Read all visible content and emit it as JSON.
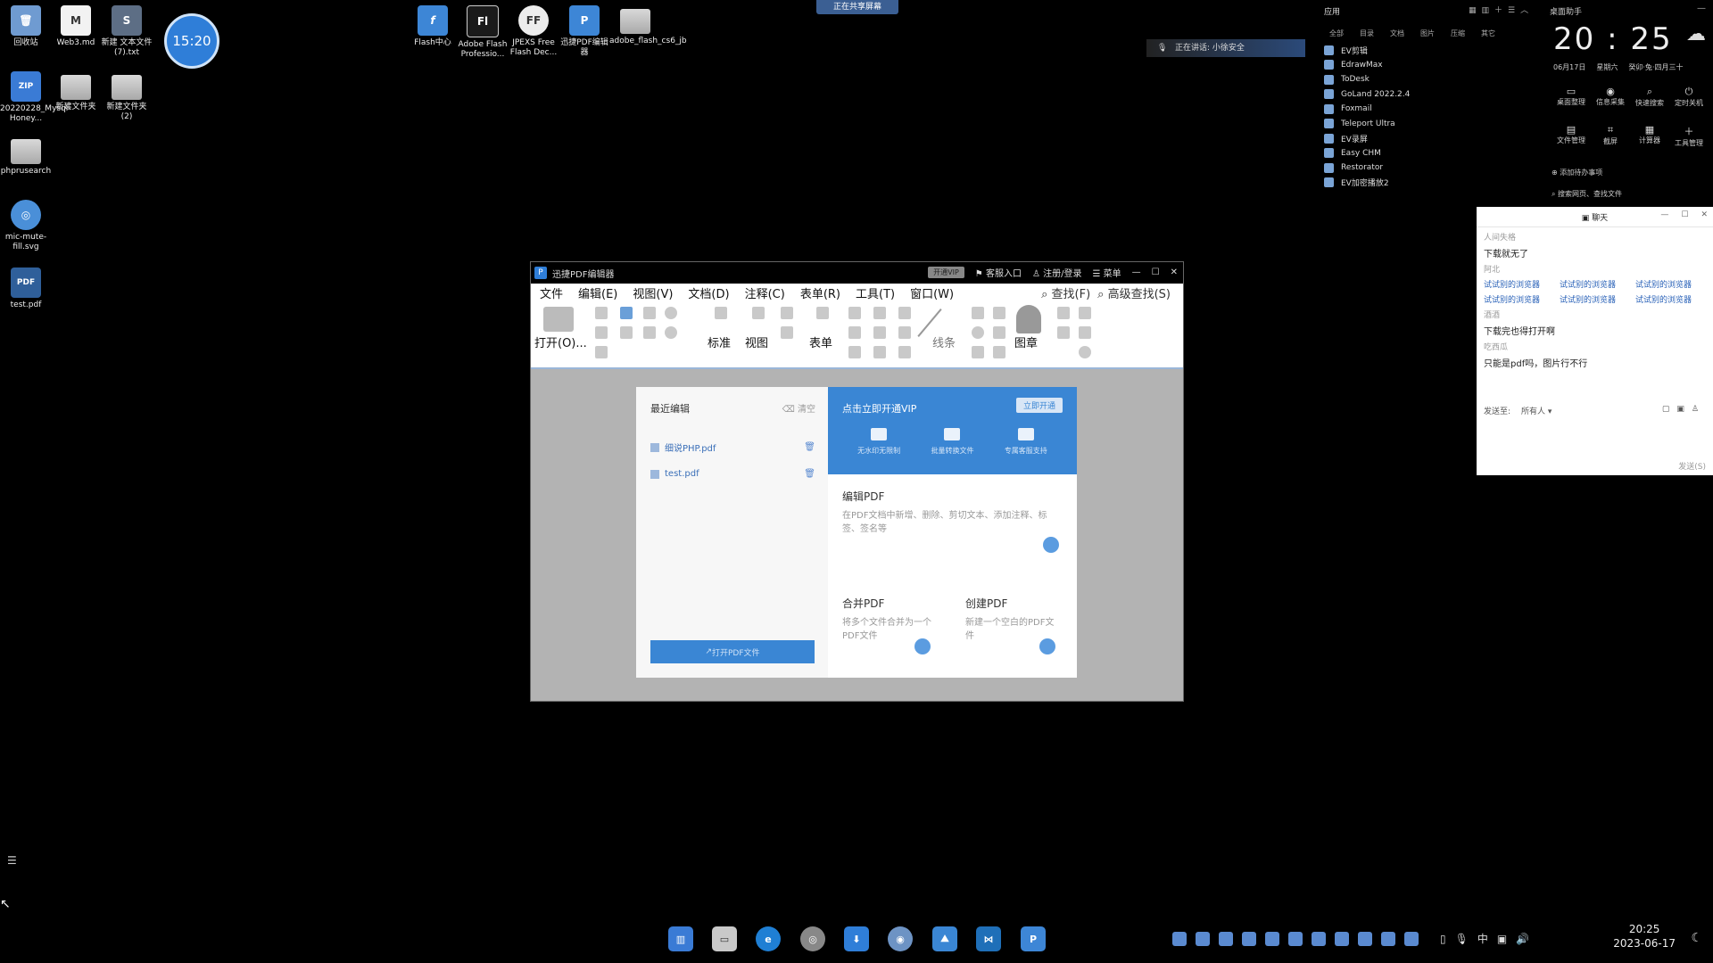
{
  "desktop": {
    "icons": [
      {
        "label": "回收站",
        "glyph": "🗑"
      },
      {
        "label": "Web3.md",
        "glyph": "M"
      },
      {
        "label": "新建 文本文件 (7).txt",
        "glyph": "S"
      },
      {
        "label": "20220228_Mysql-Honey...",
        "glyph": "ZIP"
      },
      {
        "label": "新建文件夹",
        "glyph": ""
      },
      {
        "label": "新建文件夹 (2)",
        "glyph": ""
      },
      {
        "label": "phprusearch",
        "glyph": ""
      },
      {
        "label": "mic-mute-fill.svg",
        "glyph": "◎"
      },
      {
        "label": "test.pdf",
        "glyph": "PDF"
      },
      {
        "label": "Flash中心",
        "glyph": "f"
      },
      {
        "label": "Adobe Flash Professio...",
        "glyph": "Fl"
      },
      {
        "label": "JPEXS Free Flash Dec...",
        "glyph": "FF"
      },
      {
        "label": "迅捷PDF编辑器",
        "glyph": "P"
      },
      {
        "label": "adobe_flash_cs6_jb",
        "glyph": ""
      }
    ],
    "timer": "15:20",
    "share_banner": "正在共享屏幕",
    "speaking": "正在讲话: 小徐安全"
  },
  "app_panel": {
    "title": "应用",
    "categories": [
      "全部",
      "目录",
      "文档",
      "图片",
      "压缩",
      "其它"
    ],
    "apps": [
      "EV剪辑",
      "EdrawMax",
      "ToDesk",
      "GoLand 2022.2.4",
      "Foxmail",
      "Teleport Ultra",
      "EV录屏",
      "Easy CHM",
      "Restorator",
      "EV加密播放2"
    ]
  },
  "clock_widget": {
    "title": "桌面助手",
    "time": "20 : 25",
    "date": "06月17日",
    "weekday": "星期六",
    "lunar": "癸卯·兔·四月三十",
    "quick": [
      "桌面整理",
      "信息采集",
      "快速搜索",
      "定时关机",
      "文件管理",
      "截屏",
      "计算器",
      "工具管理"
    ],
    "add_task": "添加待办事项",
    "search_hint": "搜索网页、查找文件"
  },
  "chat": {
    "title": "聊天",
    "messages": [
      {
        "type": "sys",
        "text": "人间失格"
      },
      {
        "type": "msg",
        "text": "下载就无了"
      },
      {
        "type": "sys",
        "text": "阿北"
      },
      {
        "type": "chips",
        "items": [
          "试试别的浏览器",
          "试试别的浏览器",
          "试试别的浏览器",
          "试试别的浏览器",
          "试试别的浏览器",
          "试试别的浏览器"
        ]
      },
      {
        "type": "sys",
        "text": "酒酒"
      },
      {
        "type": "msg",
        "text": "下载完也得打开啊"
      },
      {
        "type": "sys",
        "text": "吃西瓜"
      },
      {
        "type": "msg",
        "text": "只能是pdf吗，图片行不行"
      }
    ],
    "send_to_label": "发送至:",
    "send_to_value": "所有人",
    "send_button": "发送(S)"
  },
  "pdf_editor": {
    "title": "迅捷PDF编辑器",
    "vip_label": "开通VIP",
    "service_label": "客服入口",
    "login_label": "注册/登录",
    "menu_label": "菜单",
    "menus": [
      "文件",
      "编辑(E)",
      "视图(V)",
      "文档(D)",
      "注释(C)",
      "表单(R)",
      "工具(T)",
      "窗口(W)"
    ],
    "search": "查找(F)",
    "adv_search": "高级查找(S)",
    "ribbon": {
      "open": "打开(O)...",
      "standard": "标准",
      "view": "视图",
      "form": "表单",
      "lines": "线条",
      "stamp": "图章"
    },
    "start": {
      "recent_title": "最近编辑",
      "clear": "清空",
      "files": [
        "细说PHP.pdf",
        "test.pdf"
      ],
      "open_button": "打开PDF文件",
      "vip_title": "点击立即开通VIP",
      "vip_button": "立即开通",
      "vip_features": [
        "无水印无限制",
        "批量转换文件",
        "专属客服支持"
      ],
      "features": [
        {
          "title": "编辑PDF",
          "desc": "在PDF文档中新增、删除、剪切文本、添加注释、标签、签名等"
        },
        {
          "title": "合并PDF",
          "desc": "将多个文件合并为一个PDF文件"
        },
        {
          "title": "创建PDF",
          "desc": "新建一个空白的PDF文件"
        }
      ]
    }
  },
  "taskbar": {
    "apps": [
      "文件",
      "资源管理器",
      "Edge",
      "Chrome",
      "下载",
      "浏览器",
      "画图",
      "VS Code",
      "PDF编辑器"
    ],
    "ime": "中",
    "time": "20:25",
    "date": "2023-06-17"
  }
}
